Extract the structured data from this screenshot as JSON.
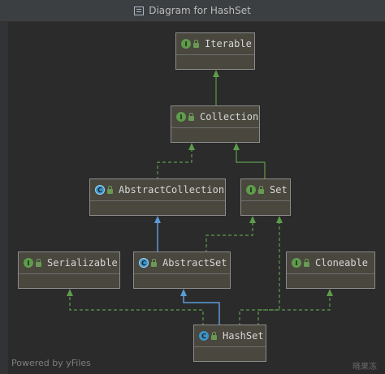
{
  "window": {
    "title": "Diagram for HashSet"
  },
  "nodes": {
    "iterable": {
      "label": "Iterable",
      "kind": "interface",
      "badge": "I"
    },
    "collection": {
      "label": "Collection",
      "kind": "interface",
      "badge": "I"
    },
    "abstract_collection": {
      "label": "AbstractCollection",
      "kind": "abstract-class",
      "badge": "C"
    },
    "set": {
      "label": "Set",
      "kind": "interface",
      "badge": "I"
    },
    "serializable": {
      "label": "Serializable",
      "kind": "interface",
      "badge": "I"
    },
    "abstract_set": {
      "label": "AbstractSet",
      "kind": "abstract-class",
      "badge": "C"
    },
    "cloneable": {
      "label": "Cloneable",
      "kind": "interface",
      "badge": "I"
    },
    "hashset": {
      "label": "HashSet",
      "kind": "class",
      "badge": "C"
    }
  },
  "edges": [
    {
      "from": "collection",
      "to": "iterable",
      "type": "extends"
    },
    {
      "from": "abstract_collection",
      "to": "collection",
      "type": "implements"
    },
    {
      "from": "set",
      "to": "collection",
      "type": "extends"
    },
    {
      "from": "abstract_set",
      "to": "abstract_collection",
      "type": "extends"
    },
    {
      "from": "abstract_set",
      "to": "set",
      "type": "implements"
    },
    {
      "from": "hashset",
      "to": "abstract_set",
      "type": "extends"
    },
    {
      "from": "hashset",
      "to": "serializable",
      "type": "implements"
    },
    {
      "from": "hashset",
      "to": "set",
      "type": "implements"
    },
    {
      "from": "hashset",
      "to": "cloneable",
      "type": "implements"
    }
  ],
  "colors": {
    "background": "#2b2b2b",
    "node_fill": "#49473e",
    "node_border": "#8c8c8c",
    "implements_edge": "#5e9c4b",
    "extends_edge": "#5a9bd6",
    "interface_badge": "#5e9c4b",
    "class_badge": "#3c93c8"
  },
  "footer": {
    "text": "Powered by yFiles"
  },
  "watermark": {
    "text": "晓果冻"
  }
}
